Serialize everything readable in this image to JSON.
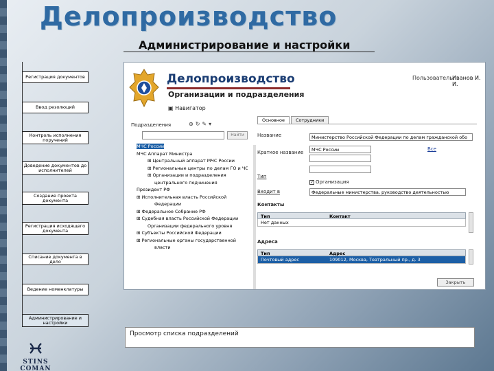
{
  "slide": {
    "title": "Делопроизводство",
    "subtitle": "Администрирование и настройки",
    "caption": "Просмотр списка подразделений"
  },
  "nav": [
    {
      "label": "Регистрация документов"
    },
    {
      "label": "Ввод резолюций"
    },
    {
      "label": "Контроль исполнения поручений"
    },
    {
      "label": "Доведение документов до исполнителей"
    },
    {
      "label": "Создание проекта документа"
    },
    {
      "label": "Регистрация исходящего документа"
    },
    {
      "label": "Списание документа в дело"
    },
    {
      "label": "Ведение номенклатуры"
    },
    {
      "label": "Администрирование и настройки"
    }
  ],
  "app": {
    "title": "Делопроизводство",
    "subtitle": "Организации и подразделения",
    "user_label": "Пользователь:",
    "user_name": "Иванов И. И.",
    "navigator": "Навигатор",
    "subdivisions_label": "Подразделения",
    "find_button": "Найти",
    "tree": [
      {
        "label": "МЧС России",
        "level": 1,
        "selected": true
      },
      {
        "label": "МЧС Аппарат Министра",
        "level": 1
      },
      {
        "label": "Центральный аппарат МЧС России",
        "level": 2
      },
      {
        "label": "Региональные центры по делам ГО и ЧС",
        "level": 2
      },
      {
        "label": "Организации и подразделения",
        "level": 2
      },
      {
        "label": "центрального подчинения",
        "level": 3
      },
      {
        "label": "Президент РФ",
        "level": 1
      },
      {
        "label": "Исполнительная власть Российской",
        "level": 1
      },
      {
        "label": "Федерации",
        "level": 3
      },
      {
        "label": "Федеральное Собрание РФ",
        "level": 1
      },
      {
        "label": "Судебная власть Российской Федерации",
        "level": 1
      },
      {
        "label": "Организации федерального уровня",
        "level": 2
      },
      {
        "label": "Субъекты Российской Федерации",
        "level": 1
      },
      {
        "label": "Региональные органы государственной",
        "level": 1
      },
      {
        "label": "власти",
        "level": 3
      }
    ],
    "tabs": [
      {
        "label": "Основное",
        "active": true
      },
      {
        "label": "Сотрудники",
        "active": false
      }
    ],
    "fields": {
      "name_label": "Название",
      "name_value": "Министерство Российской Федерации по делам гражданской обо",
      "short_label": "Краткое название",
      "short_value": "МЧС России",
      "chief_link": "Все",
      "type_label": "Тип",
      "type_option": "Организация",
      "parent_label": "Входит в",
      "parent_value": "Федеральные министерства, руководство деятельностью",
      "contacts_label": "Контакты",
      "address_label": "Адреса"
    },
    "contacts_grid": {
      "headers": [
        "Тип",
        "Контакт"
      ],
      "rows": [
        [
          "Нет данных",
          ""
        ]
      ]
    },
    "address_grid": {
      "headers": [
        "Тип",
        "Адрес"
      ],
      "rows": [
        [
          "Почтовый адрес",
          "109012, Москва, Театральный пр., д. 3"
        ]
      ]
    },
    "close_button": "Закрыть"
  },
  "logo": {
    "text": "STINS COMAN"
  },
  "colors": {
    "title_blue": "#2f6aa3",
    "app_title": "#1b3d73",
    "selection": "#1c5fa6"
  }
}
